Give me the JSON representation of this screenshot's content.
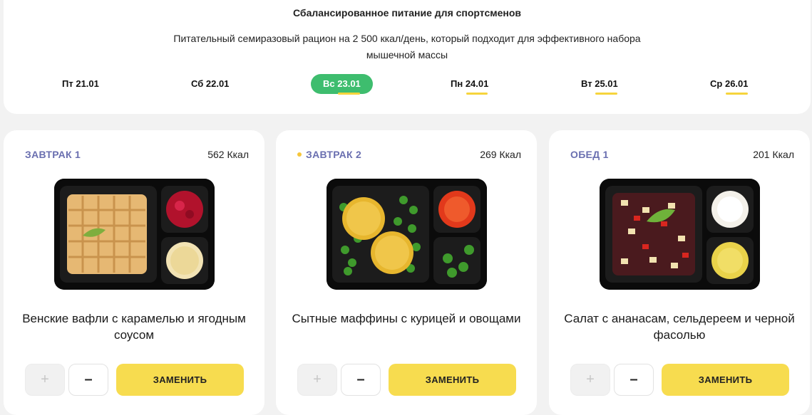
{
  "header": {
    "title": "Сбалансированное питание для спортсменов",
    "description": "Питательный семиразовый рацион на 2 500 ккал/день, который подходит для эффективного набора мышечной массы"
  },
  "days": [
    {
      "dow": "Пт",
      "date": "21.01",
      "active": false,
      "marked": false
    },
    {
      "dow": "Сб",
      "date": "22.01",
      "active": false,
      "marked": false
    },
    {
      "dow": "Вс",
      "date": "23.01",
      "active": true,
      "marked": true
    },
    {
      "dow": "Пн",
      "date": "24.01",
      "active": false,
      "marked": true
    },
    {
      "dow": "Вт",
      "date": "25.01",
      "active": false,
      "marked": true
    },
    {
      "dow": "Ср",
      "date": "26.01",
      "active": false,
      "marked": true
    }
  ],
  "meals": [
    {
      "label": "ЗАВТРАК 1",
      "kcal": "562 Ккал",
      "name": "Венские вафли с карамелью и ягодным соусом",
      "dot": false
    },
    {
      "label": "ЗАВТРАК 2",
      "kcal": "269 Ккал",
      "name": "Сытные маффины с курицей и овощами",
      "dot": true
    },
    {
      "label": "ОБЕД 1",
      "kcal": "201 Ккал",
      "name": "Салат с ананасам, сельдереем и черной фасолью",
      "dot": false
    }
  ],
  "controls": {
    "plus": "+",
    "minus": "–",
    "replace": "ЗАМЕНИТЬ"
  },
  "colors": {
    "active_day": "#3ebd6e",
    "underline": "#f6d43c",
    "meal_label": "#6a6fb0",
    "replace_button": "#f7dc4f"
  }
}
